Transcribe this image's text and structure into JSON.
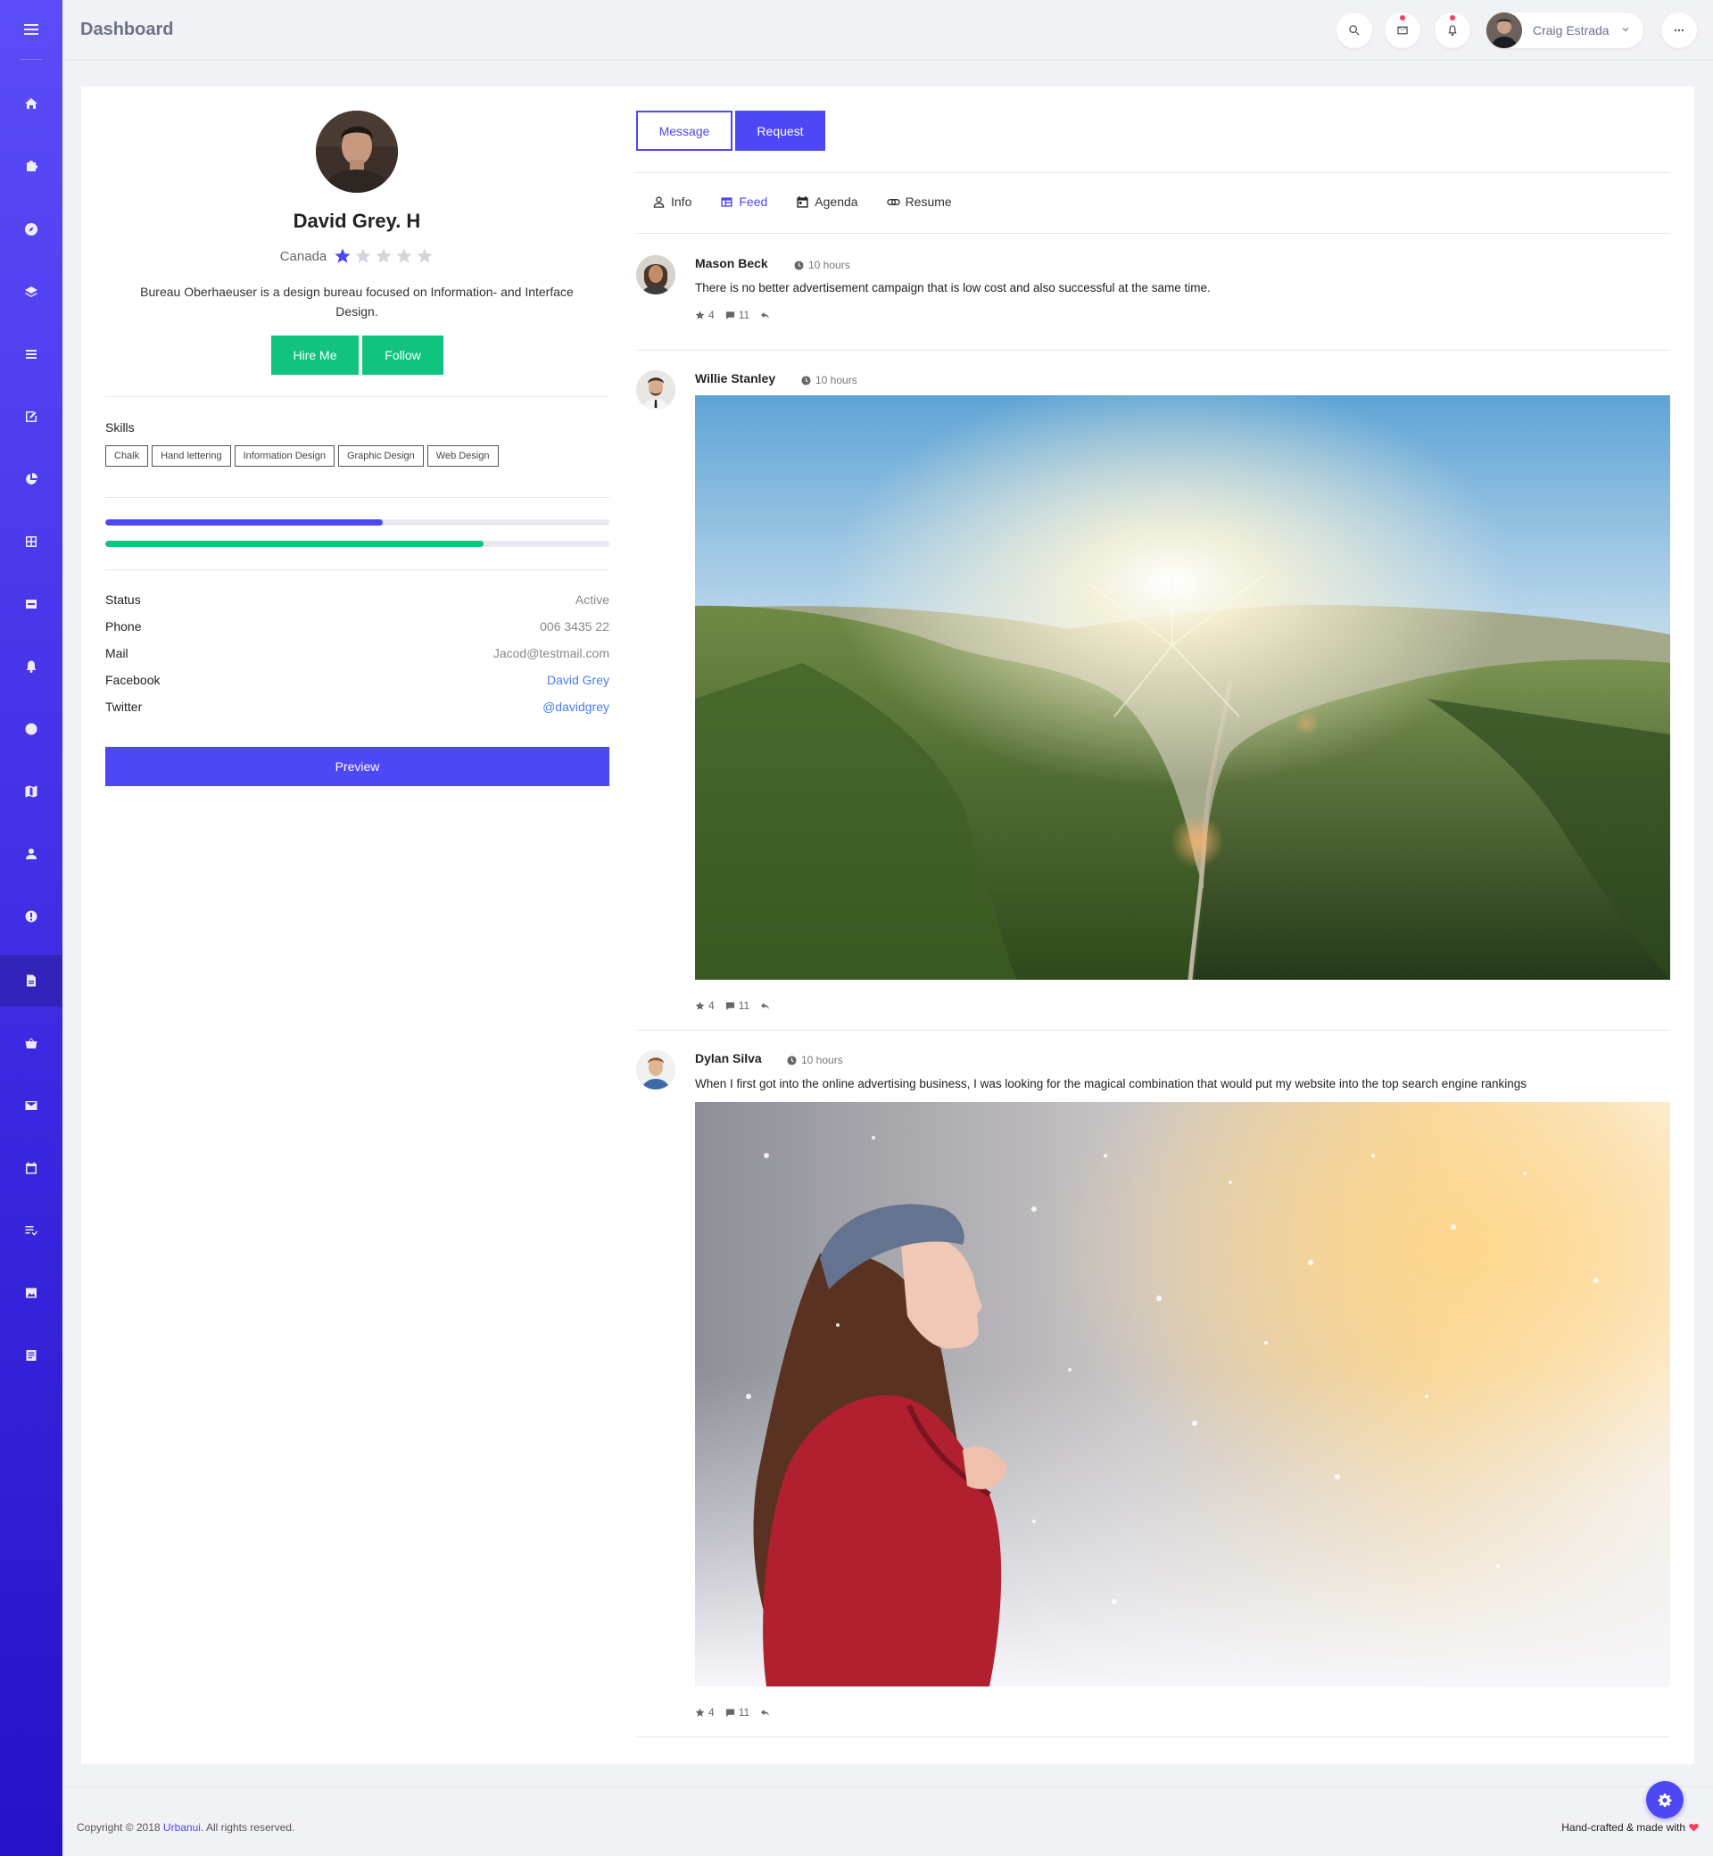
{
  "topbar": {
    "title": "Dashboard",
    "user_name": "Craig Estrada",
    "icons": [
      "search-icon",
      "mail-icon",
      "bell-icon",
      "more-icon"
    ]
  },
  "sidebar": {
    "items": [
      "menu",
      "home",
      "puzzle",
      "compass",
      "layers",
      "list",
      "edit",
      "chart",
      "grid",
      "card",
      "bell",
      "circle",
      "map",
      "user",
      "alert",
      "page",
      "basket",
      "mail",
      "calendar",
      "checklist",
      "image",
      "document"
    ],
    "active_item": "page"
  },
  "profile": {
    "name": "David Grey. H",
    "location": "Canada",
    "rating": 1,
    "rating_max": 5,
    "bio": "Bureau Oberhaeuser is a design bureau focused on Information- and Interface Design.",
    "hire_label": "Hire Me",
    "follow_label": "Follow",
    "skills_label": "Skills",
    "skills": [
      "Chalk",
      "Hand lettering",
      "Information Design",
      "Graphic Design",
      "Web Design"
    ],
    "progress": [
      {
        "value": 0.55,
        "color": "#4e47f6"
      },
      {
        "value": 0.75,
        "color": "#10c37e"
      }
    ],
    "details": [
      {
        "label": "Status",
        "value": "Active",
        "link": false
      },
      {
        "label": "Phone",
        "value": "006 3435 22",
        "link": false
      },
      {
        "label": "Mail",
        "value": "Jacod@testmail.com",
        "link": false
      },
      {
        "label": "Facebook",
        "value": "David Grey",
        "link": true
      },
      {
        "label": "Twitter",
        "value": "@davidgrey",
        "link": true
      }
    ],
    "preview_label": "Preview"
  },
  "actions": {
    "message_label": "Message",
    "request_label": "Request"
  },
  "tabs": [
    {
      "label": "Info",
      "icon": "user-icon",
      "active": false
    },
    {
      "label": "Feed",
      "icon": "feed-icon",
      "active": true
    },
    {
      "label": "Agenda",
      "icon": "calendar-icon",
      "active": false
    },
    {
      "label": "Resume",
      "icon": "link-icon",
      "active": false
    }
  ],
  "posts": [
    {
      "author": "Mason Beck",
      "time": "10 hours",
      "text": "There is no better advertisement campaign that is low cost and also successful at the same time.",
      "stars": "4",
      "comments": "11",
      "image": "none"
    },
    {
      "author": "Willie Stanley",
      "time": "10 hours",
      "text": "",
      "stars": "4",
      "comments": "11",
      "image": "mountain-landscape"
    },
    {
      "author": "Dylan Silva",
      "time": "10 hours",
      "text": "When I first got into the online advertising business, I was looking for the magical combination that would put my website into the top search engine rankings",
      "stars": "4",
      "comments": "11",
      "image": "winter-portrait"
    }
  ],
  "footer": {
    "copyright_prefix": "Copyright © 2018 ",
    "brand": "Urbanui",
    "copyright_suffix": ". All rights reserved.",
    "handcrafted": "Hand-crafted & made with"
  },
  "colors": {
    "accent": "#4e47f6",
    "success": "#10c37e",
    "link": "#4a7df0",
    "notify": "#f43f5e"
  }
}
